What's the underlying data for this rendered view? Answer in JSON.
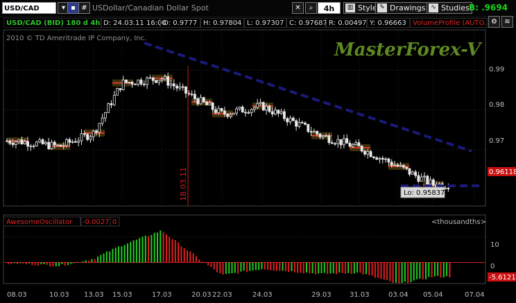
{
  "toolbar": {
    "symbol": "USD/CAD",
    "description": "USDollar/Canadian Dollar Spot",
    "timeframe": "4h",
    "style_label": "Style",
    "drawings_label": "Drawings",
    "studies_label": "Studies",
    "bid_label": "B: .9694",
    "hash_label": "#"
  },
  "infobar": {
    "symbol": "USD/CAD (BID) 180 d 4h",
    "date": "D: 24.03.11 16:00",
    "open": "O: 0.9777",
    "high": "H: 0.97804",
    "low": "L: 0.97307",
    "close": "C: 0.97687",
    "range": "R: 0.00497",
    "y": "Y: 0.96663",
    "volume_profile": "VolumeProfile (AUTO..."
  },
  "price_panel": {
    "copyright": "2010 © TD Ameritrade IP Company, Inc.",
    "watermark": "MasterForex-V",
    "y_ticks": [
      "0.99",
      "0.98",
      "0.97"
    ],
    "current_price_label": "0.96118",
    "marker_date": "18.03.11",
    "low_label": "Lo: 0.95837"
  },
  "oscillator": {
    "name": "AwesomeOscillator",
    "value": "-0.0027",
    "zero": "0",
    "units": "<thousandths>",
    "y_ticks": [
      "10",
      "0"
    ],
    "current_label": "-5.6121"
  },
  "x_axis": [
    "08.03",
    "10.03",
    "13.03",
    "15.03",
    "17.03",
    "20.03",
    "22.03",
    "24.03",
    "29.03",
    "31.03",
    "03.04",
    "05.04",
    "07.04"
  ],
  "colors": {
    "up_bar": "#22cc22",
    "down_bar": "#e02020",
    "trendline": "#1a1a7a",
    "vertical_marker": "#d01818",
    "bid": "#19d219"
  },
  "chart_data": [
    {
      "type": "line",
      "title": "USD/CAD (BID) 180 d 4h",
      "x": [
        "08.03",
        "10.03",
        "13.03",
        "15.03",
        "17.03",
        "20.03",
        "22.03",
        "24.03",
        "29.03",
        "31.03",
        "03.04",
        "05.04"
      ],
      "series": [
        {
          "name": "USD/CAD",
          "values": [
            0.9722,
            0.9708,
            0.9742,
            0.9868,
            0.988,
            0.982,
            0.979,
            0.981,
            0.9735,
            0.9705,
            0.9658,
            0.9612
          ]
        }
      ],
      "ylim": [
        0.956,
        1.0
      ],
      "annotations": [
        "Lo: 0.95837",
        "18.03.11",
        "0.96118"
      ]
    },
    {
      "type": "bar",
      "title": "AwesomeOscillator",
      "categories": [
        "08.03",
        "10.03",
        "13.03",
        "15.03",
        "17.03",
        "20.03",
        "22.03",
        "24.03",
        "29.03",
        "31.03",
        "03.04",
        "05.04"
      ],
      "values": [
        -0.4,
        -1.3,
        1.5,
        6.8,
        12.5,
        0.8,
        -5.0,
        -2.5,
        -4.5,
        -4.0,
        -8.5,
        -5.6
      ],
      "ylabel": "<thousandths>",
      "ylim": [
        -8,
        14
      ]
    }
  ]
}
